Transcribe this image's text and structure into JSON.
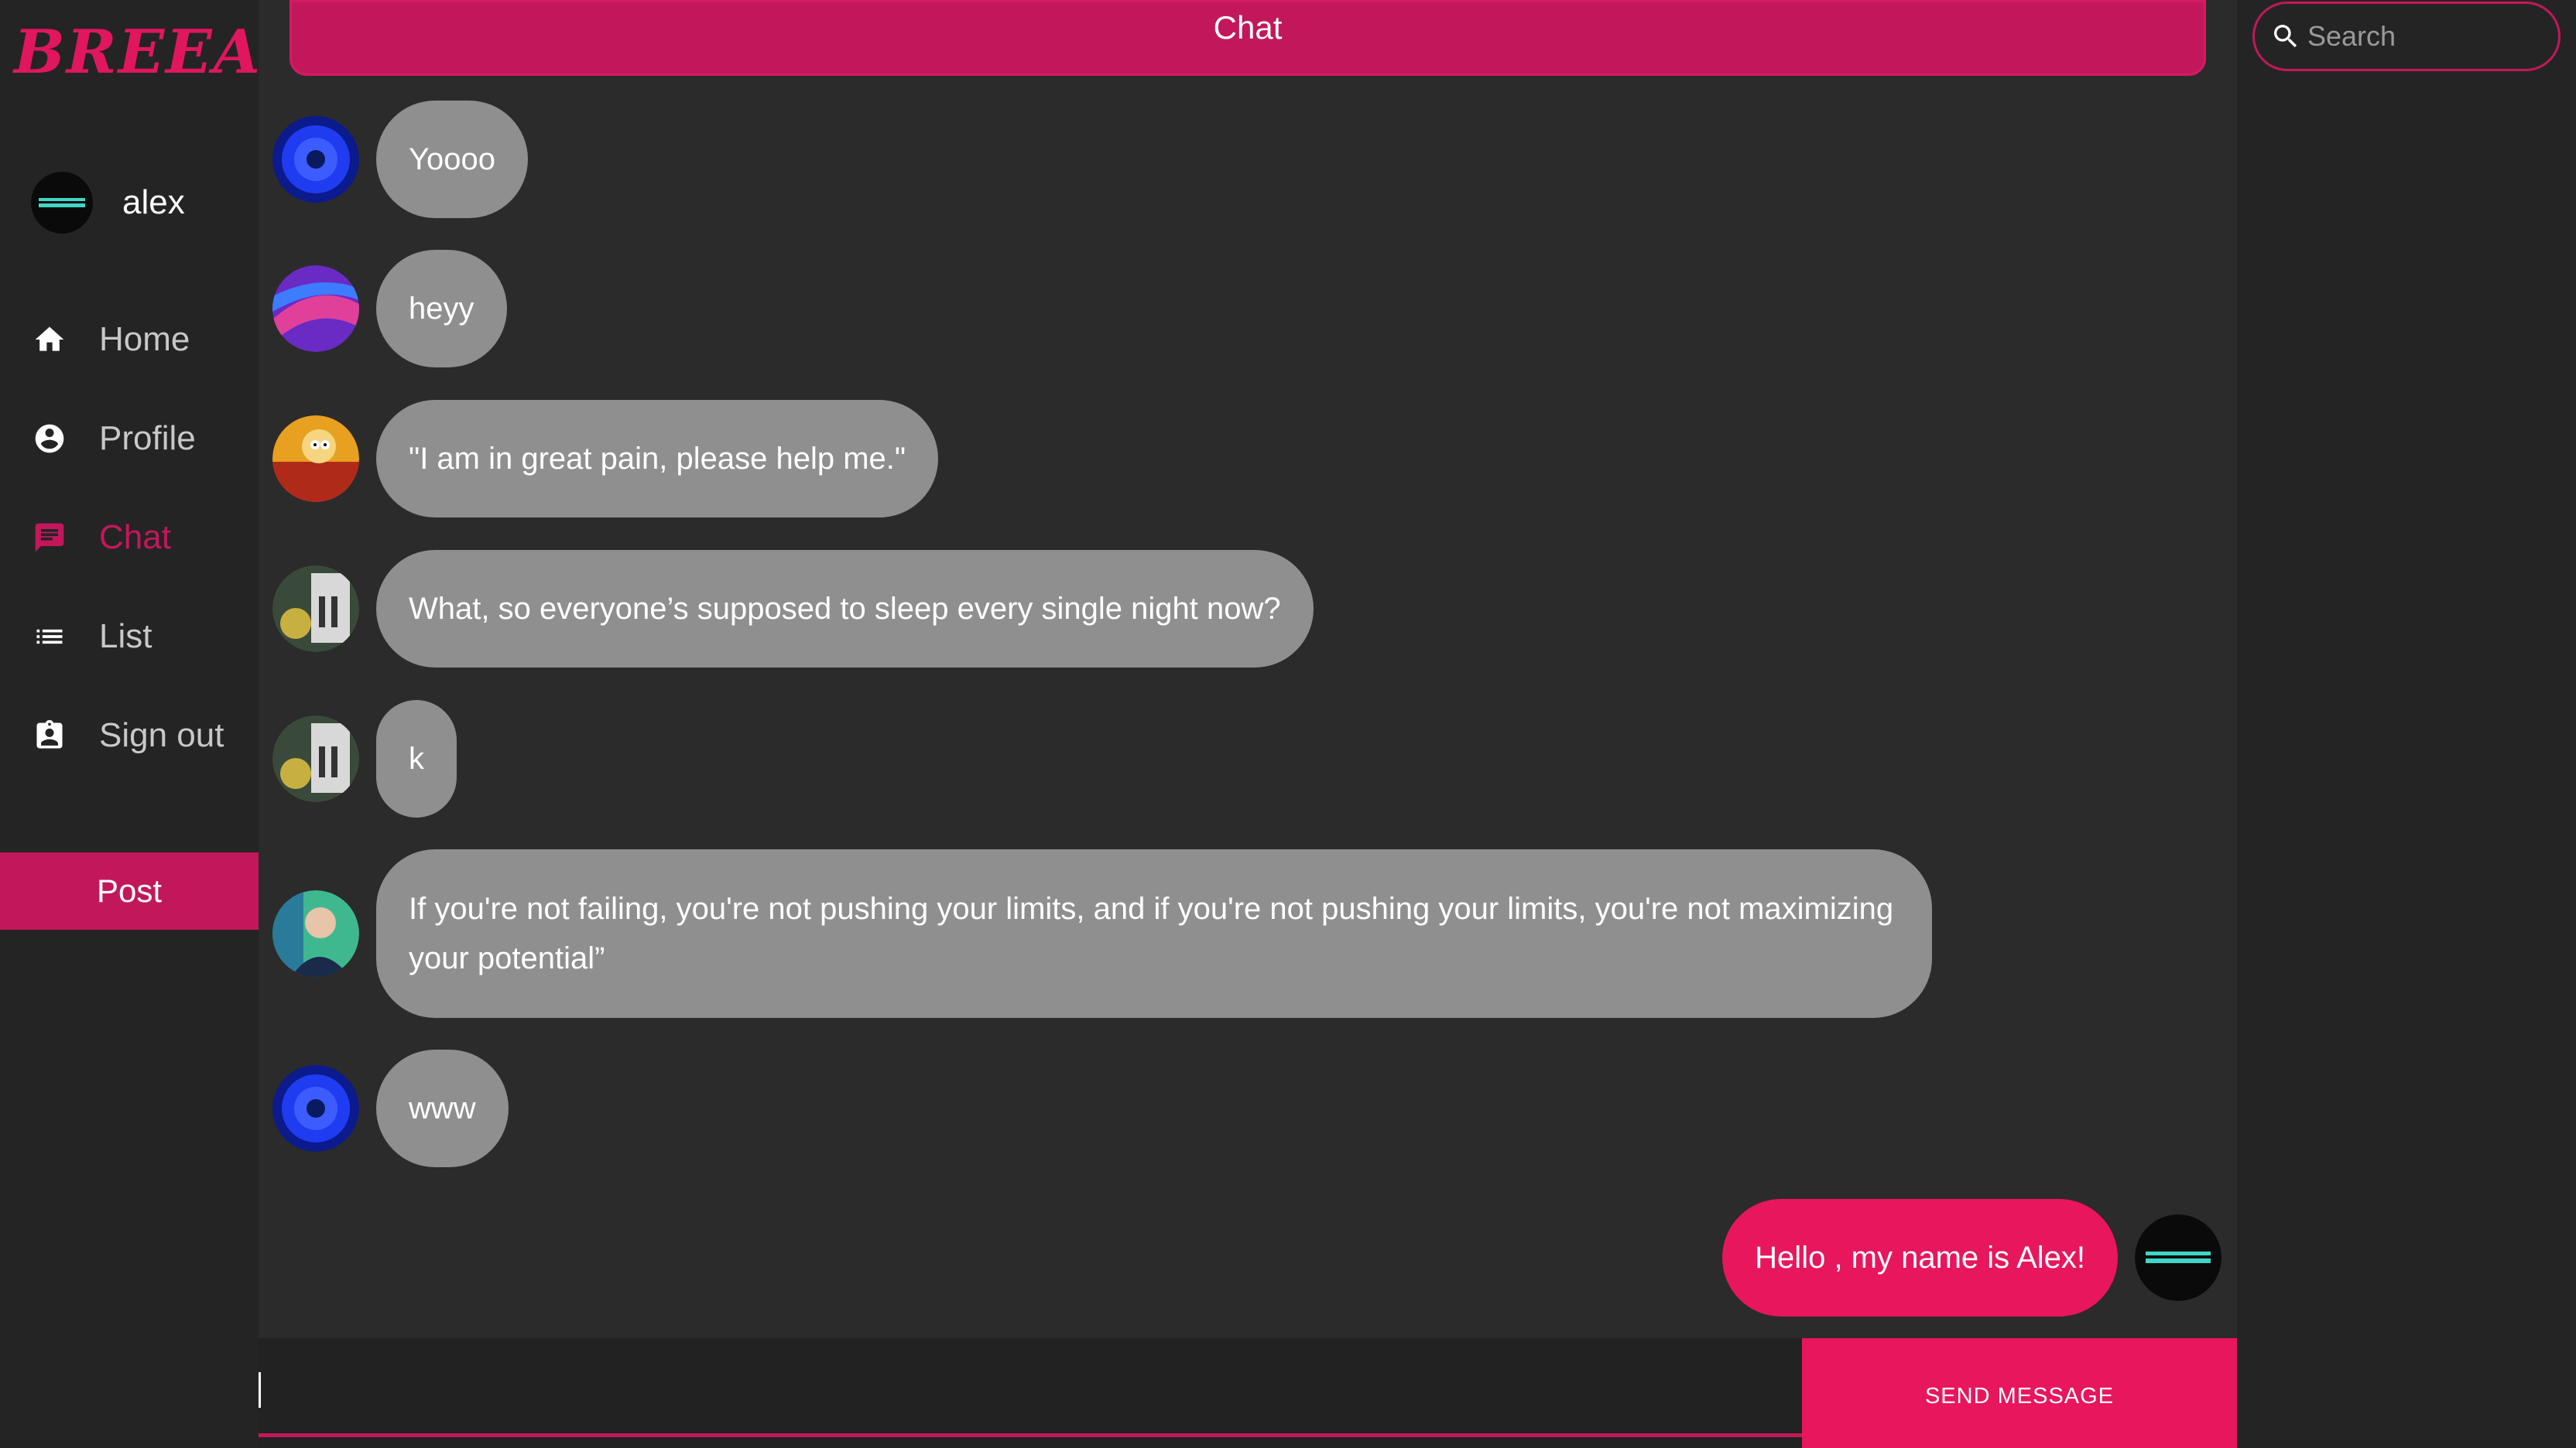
{
  "brand": {
    "logo_text": "BREEAB",
    "accent": "#e8165c"
  },
  "user": {
    "name": "alex"
  },
  "sidebar": {
    "items": [
      {
        "label": "Home",
        "icon": "home-icon",
        "active": false
      },
      {
        "label": "Profile",
        "icon": "account-circle-icon",
        "active": false
      },
      {
        "label": "Chat",
        "icon": "chat-icon",
        "active": true
      },
      {
        "label": "List",
        "icon": "list-icon",
        "active": false
      },
      {
        "label": "Sign out",
        "icon": "badge-icon",
        "active": false
      }
    ],
    "post_label": "Post"
  },
  "chat": {
    "title": "Chat",
    "messages": [
      {
        "text": "Yoooo",
        "avatar": "blue-flower-avatar",
        "mine": false
      },
      {
        "text": "heyy",
        "avatar": "purple-feather-avatar",
        "mine": false
      },
      {
        "text": "\"I am in great pain, please help me.\"",
        "avatar": "cartoon-avatar",
        "mine": false
      },
      {
        "text": "What, so everyone’s supposed to sleep every single night now?",
        "avatar": "rick-avatar",
        "mine": false
      },
      {
        "text": "k",
        "avatar": "rick-avatar",
        "mine": false
      },
      {
        "text": "If you're not failing, you're not pushing your limits, and if you're not pushing your limits, you're not maximizing your potential”",
        "avatar": "speaker-avatar",
        "mine": false
      },
      {
        "text": "www",
        "avatar": "blue-flower-avatar",
        "mine": false
      },
      {
        "text": "Hello , my name is Alex!",
        "avatar": "user-avatar",
        "mine": true
      }
    ],
    "composer_value": "",
    "send_label": "SEND MESSAGE"
  },
  "search": {
    "placeholder": "Search",
    "value": ""
  }
}
